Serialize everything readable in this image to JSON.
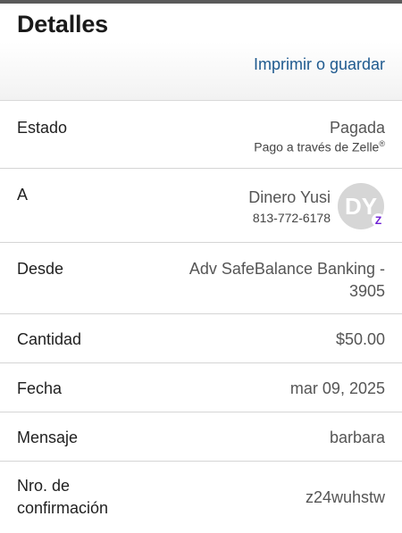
{
  "header": {
    "title": "Detalles",
    "print_link": "Imprimir o guardar"
  },
  "details": {
    "status": {
      "label": "Estado",
      "value": "Pagada",
      "sub": "Pago a través de Zelle",
      "sub_mark": "®"
    },
    "recipient": {
      "label": "A",
      "name": "Dinero Yusi",
      "phone": "813-772-6178",
      "avatar_initials": "DY",
      "badge_icon": "zelle-icon"
    },
    "from": {
      "label": "Desde",
      "value_line1": "Adv SafeBalance Banking -",
      "value_line2": "3905"
    },
    "amount": {
      "label": "Cantidad",
      "value": "$50.00"
    },
    "date": {
      "label": "Fecha",
      "value": "mar 09, 2025"
    },
    "message": {
      "label": "Mensaje",
      "value": "barbara"
    },
    "confirmation": {
      "label_line1": "Nro. de",
      "label_line2": "confirmación",
      "value": "z24wuhstw"
    }
  },
  "colors": {
    "link": "#1f5a8f",
    "zelle_purple": "#6d1ed4",
    "avatar_bg": "#d6d6d6"
  }
}
